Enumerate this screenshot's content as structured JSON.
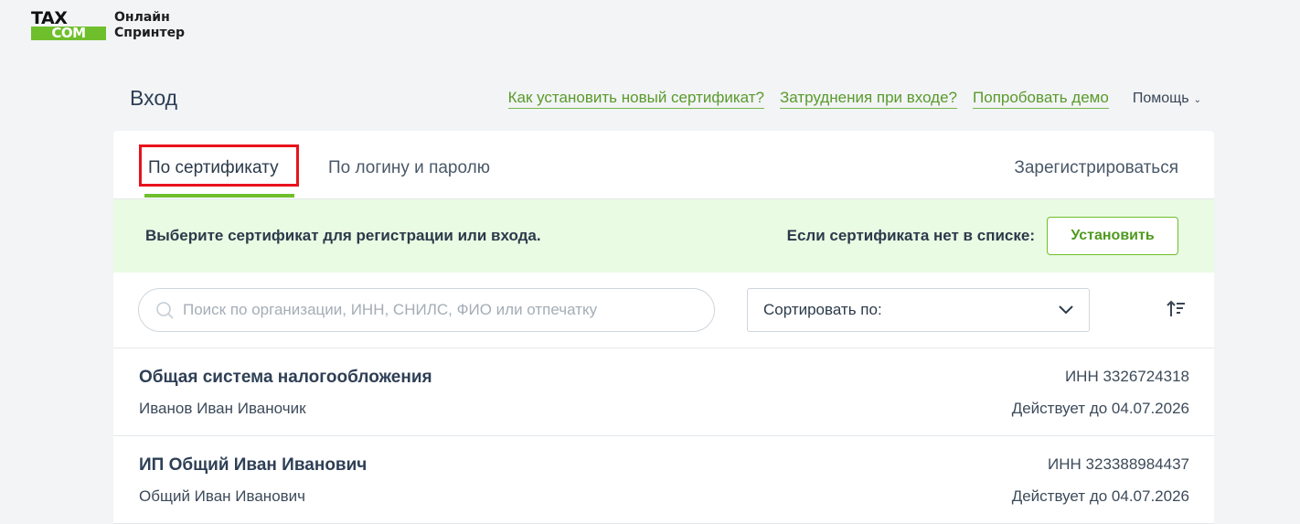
{
  "logo": {
    "mark_top": "TAX",
    "mark_bottom": "COM",
    "line1": "Онлайн",
    "line2": "Спринтер",
    "brand_color": "#6fbf2c"
  },
  "header": {
    "title": "Вход",
    "links": [
      "Как установить новый сертификат?",
      "Затруднения при входе?",
      "Попробовать демо"
    ],
    "help_label": "Помощь"
  },
  "tabs": {
    "certificate": "По сертификату",
    "login_password": "По логину и паролю",
    "register": "Зарегистрироваться",
    "active": "certificate"
  },
  "banner": {
    "text": "Выберите сертификат для регистрации или входа.",
    "note": "Если сертификата нет в списке:",
    "install_button": "Установить"
  },
  "search": {
    "placeholder": "Поиск по организации, ИНН, СНИЛС, ФИО или отпечатку",
    "value": ""
  },
  "sort": {
    "label": "Сортировать по:"
  },
  "certificates": [
    {
      "organization": "Общая система налогообложения",
      "owner": "Иванов Иван Иваночик",
      "inn": "ИНН 3326724318",
      "valid_until": "Действует до 04.07.2026"
    },
    {
      "organization": "ИП Общий Иван Иванович",
      "owner": "Общий Иван Иванович",
      "inn": "ИНН 323388984437",
      "valid_until": "Действует до 04.07.2026"
    }
  ],
  "colors": {
    "accent": "#6fbf2c",
    "highlight": "#e8121c",
    "banner_bg": "#e9fbe3",
    "page_bg": "#f2f4f6"
  }
}
